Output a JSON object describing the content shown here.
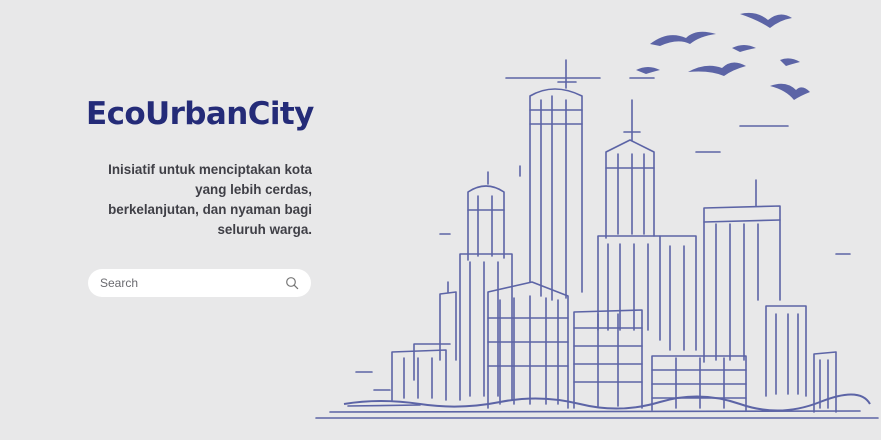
{
  "brand": {
    "name": "EcoUrbanCity"
  },
  "hero": {
    "tagline_lines": [
      "Inisiatif untuk menciptakan kota",
      "yang lebih cerdas,",
      "berkelanjutan, dan nyaman bagi",
      "seluruh warga."
    ]
  },
  "search": {
    "placeholder": "Search",
    "value": "",
    "icon": "search-icon"
  },
  "colors": {
    "brand": "#242b78",
    "sketch": "#5c64a6",
    "background": "#e8e8e9",
    "search_bg": "#ffffff"
  }
}
